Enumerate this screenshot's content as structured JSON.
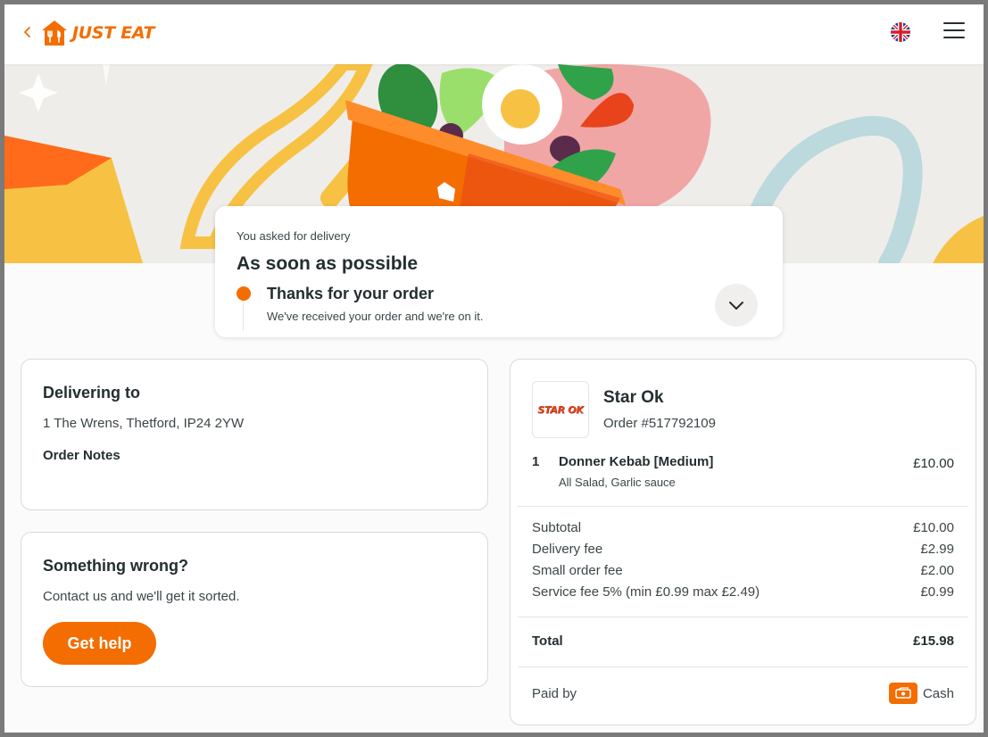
{
  "header": {
    "brand": "JUST EAT",
    "back_icon": "chevron-left-icon",
    "language_icon": "uk-flag-icon",
    "menu_icon": "hamburger-menu-icon"
  },
  "status": {
    "label": "You asked for delivery",
    "title": "As soon as possible",
    "step_title": "Thanks for your order",
    "step_desc": "We've received your order and we're on it."
  },
  "delivery": {
    "title": "Delivering to",
    "address": "1 The Wrens, Thetford, IP24 2YW",
    "notes_label": "Order Notes"
  },
  "help": {
    "title": "Something wrong?",
    "text": "Contact us and we'll get it sorted.",
    "button": "Get help"
  },
  "order": {
    "restaurant_logo_text": "STAR OK",
    "restaurant": "Star Ok",
    "order_number": "Order #517792109",
    "item": {
      "qty": "1",
      "name": "Donner Kebab [Medium]",
      "mods": "All Salad, Garlic sauce",
      "price": "£10.00"
    },
    "fees": [
      {
        "label": "Subtotal",
        "value": "£10.00"
      },
      {
        "label": "Delivery fee",
        "value": "£2.99"
      },
      {
        "label": "Small order fee",
        "value": "£2.00"
      },
      {
        "label": "Service fee 5% (min £0.99 max £2.49)",
        "value": "£0.99"
      }
    ],
    "total_label": "Total",
    "total_value": "£15.98",
    "paid_label": "Paid by",
    "paid_method": "Cash"
  },
  "colors": {
    "brand_orange": "#f36d00",
    "text_dark": "#242e30",
    "text_mid": "#3c4548"
  }
}
